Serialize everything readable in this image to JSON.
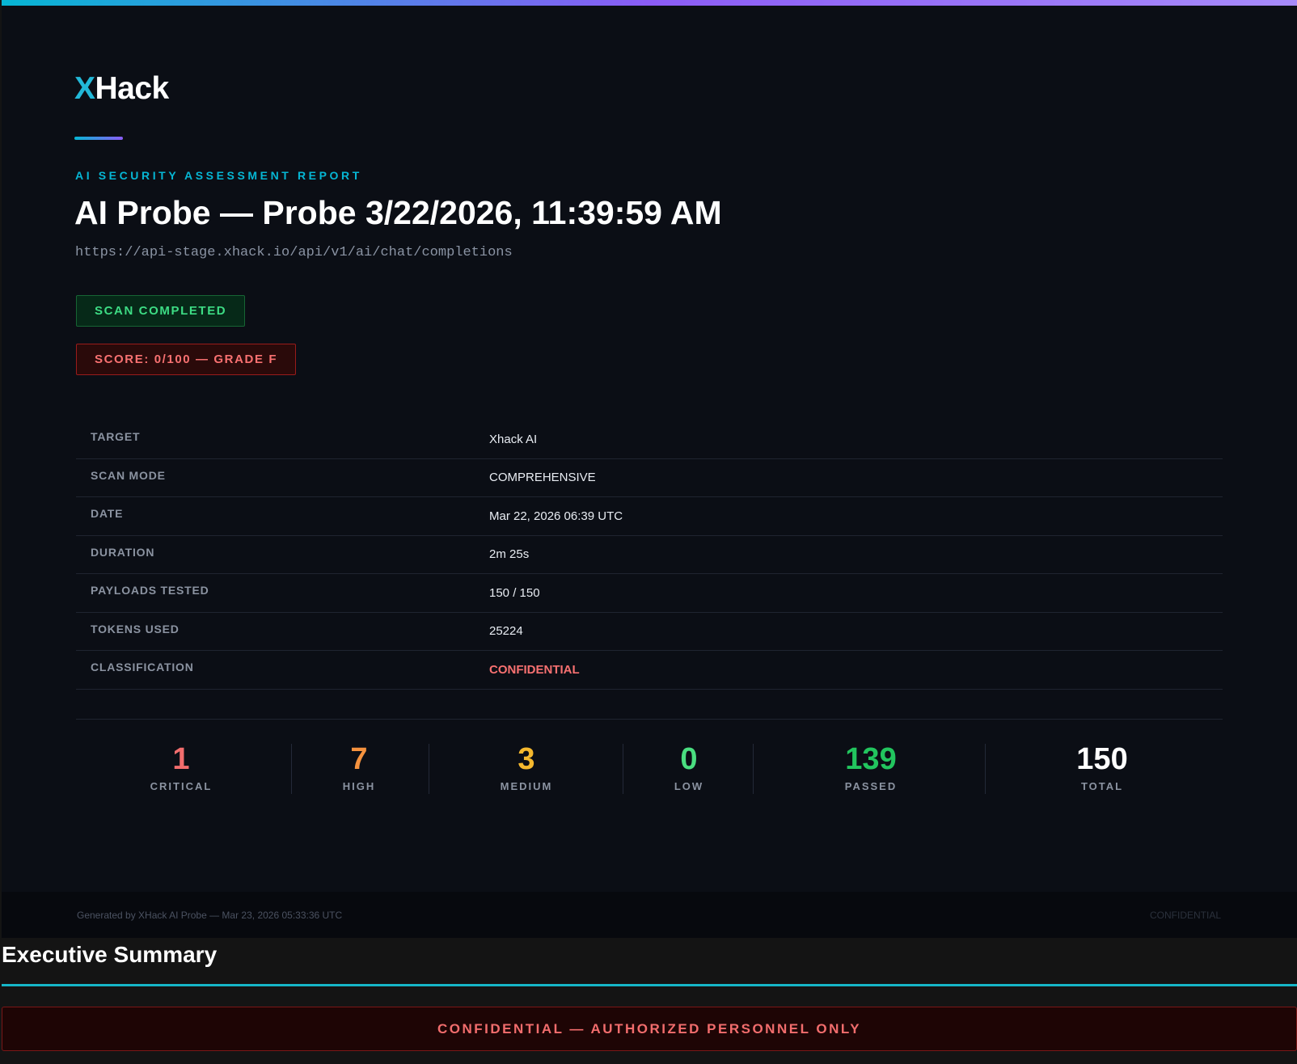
{
  "brand": {
    "logo_x": "X",
    "logo_rest": "Hack"
  },
  "report": {
    "eyebrow": "AI SECURITY ASSESSMENT REPORT",
    "title": "AI Probe — Probe 3/22/2026, 11:39:59 AM",
    "url": "https://api-stage.xhack.io/api/v1/ai/chat/completions",
    "status_badge": "SCAN COMPLETED",
    "score_badge": "SCORE: 0/100 — GRADE F"
  },
  "meta": [
    {
      "key": "TARGET",
      "value": "Xhack AI"
    },
    {
      "key": "SCAN MODE",
      "value": "COMPREHENSIVE"
    },
    {
      "key": "DATE",
      "value": "Mar 22, 2026 06:39 UTC"
    },
    {
      "key": "DURATION",
      "value": "2m 25s"
    },
    {
      "key": "PAYLOADS TESTED",
      "value": "150 / 150"
    },
    {
      "key": "TOKENS USED",
      "value": "25224"
    },
    {
      "key": "CLASSIFICATION",
      "value": "CONFIDENTIAL"
    }
  ],
  "stats": [
    {
      "value": "1",
      "label": "CRITICAL",
      "color": "#f26d6d"
    },
    {
      "value": "7",
      "label": "HIGH",
      "color": "#f5923e"
    },
    {
      "value": "3",
      "label": "MEDIUM",
      "color": "#f5b82e"
    },
    {
      "value": "0",
      "label": "LOW",
      "color": "#4ade80"
    },
    {
      "value": "139",
      "label": "PASSED",
      "color": "#22c55e"
    },
    {
      "value": "150",
      "label": "TOTAL",
      "color": "#ffffff"
    }
  ],
  "footer": {
    "generated": "Generated by XHack AI Probe — Mar 23, 2026 05:33:36 UTC",
    "classification": "CONFIDENTIAL"
  },
  "executive_summary": {
    "title": "Executive Summary",
    "banner": "CONFIDENTIAL — AUTHORIZED PERSONNEL ONLY"
  },
  "colors": {
    "accent_cyan": "#06b6d4",
    "accent_violet": "#8b5cf6",
    "danger": "#f87171",
    "success": "#3ddc84"
  }
}
